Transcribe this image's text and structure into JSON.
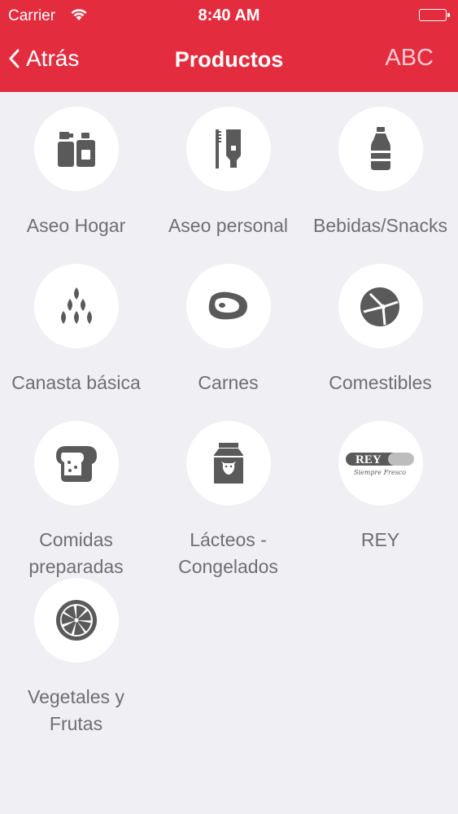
{
  "status_bar": {
    "carrier": "Carrier",
    "time": "8:40 AM"
  },
  "nav": {
    "back_label": "Atrás",
    "title": "Productos",
    "right_label": "ABC"
  },
  "categories": [
    {
      "label": "Aseo Hogar",
      "icon": "cleaning-bottles-icon"
    },
    {
      "label": "Aseo personal",
      "icon": "toothbrush-toothpaste-icon"
    },
    {
      "label": "Bebidas/Snacks",
      "icon": "bottle-icon"
    },
    {
      "label": "Canasta básica",
      "icon": "grains-icon"
    },
    {
      "label": "Carnes",
      "icon": "steak-icon"
    },
    {
      "label": "Comestibles",
      "icon": "cookie-icon"
    },
    {
      "label": "Comidas preparadas",
      "icon": "bread-icon"
    },
    {
      "label": "Lácteos - Congelados",
      "icon": "milk-carton-icon"
    },
    {
      "label": "REY",
      "icon": "rey-logo",
      "logo_text": "REY",
      "logo_tagline": "Siempre Fresco"
    },
    {
      "label": "Vegetales y Frutas",
      "icon": "citrus-slice-icon"
    }
  ],
  "colors": {
    "header": "#e32d3f",
    "icon": "#5a5a5a",
    "background": "#efeff4",
    "label": "#6e6e73"
  }
}
